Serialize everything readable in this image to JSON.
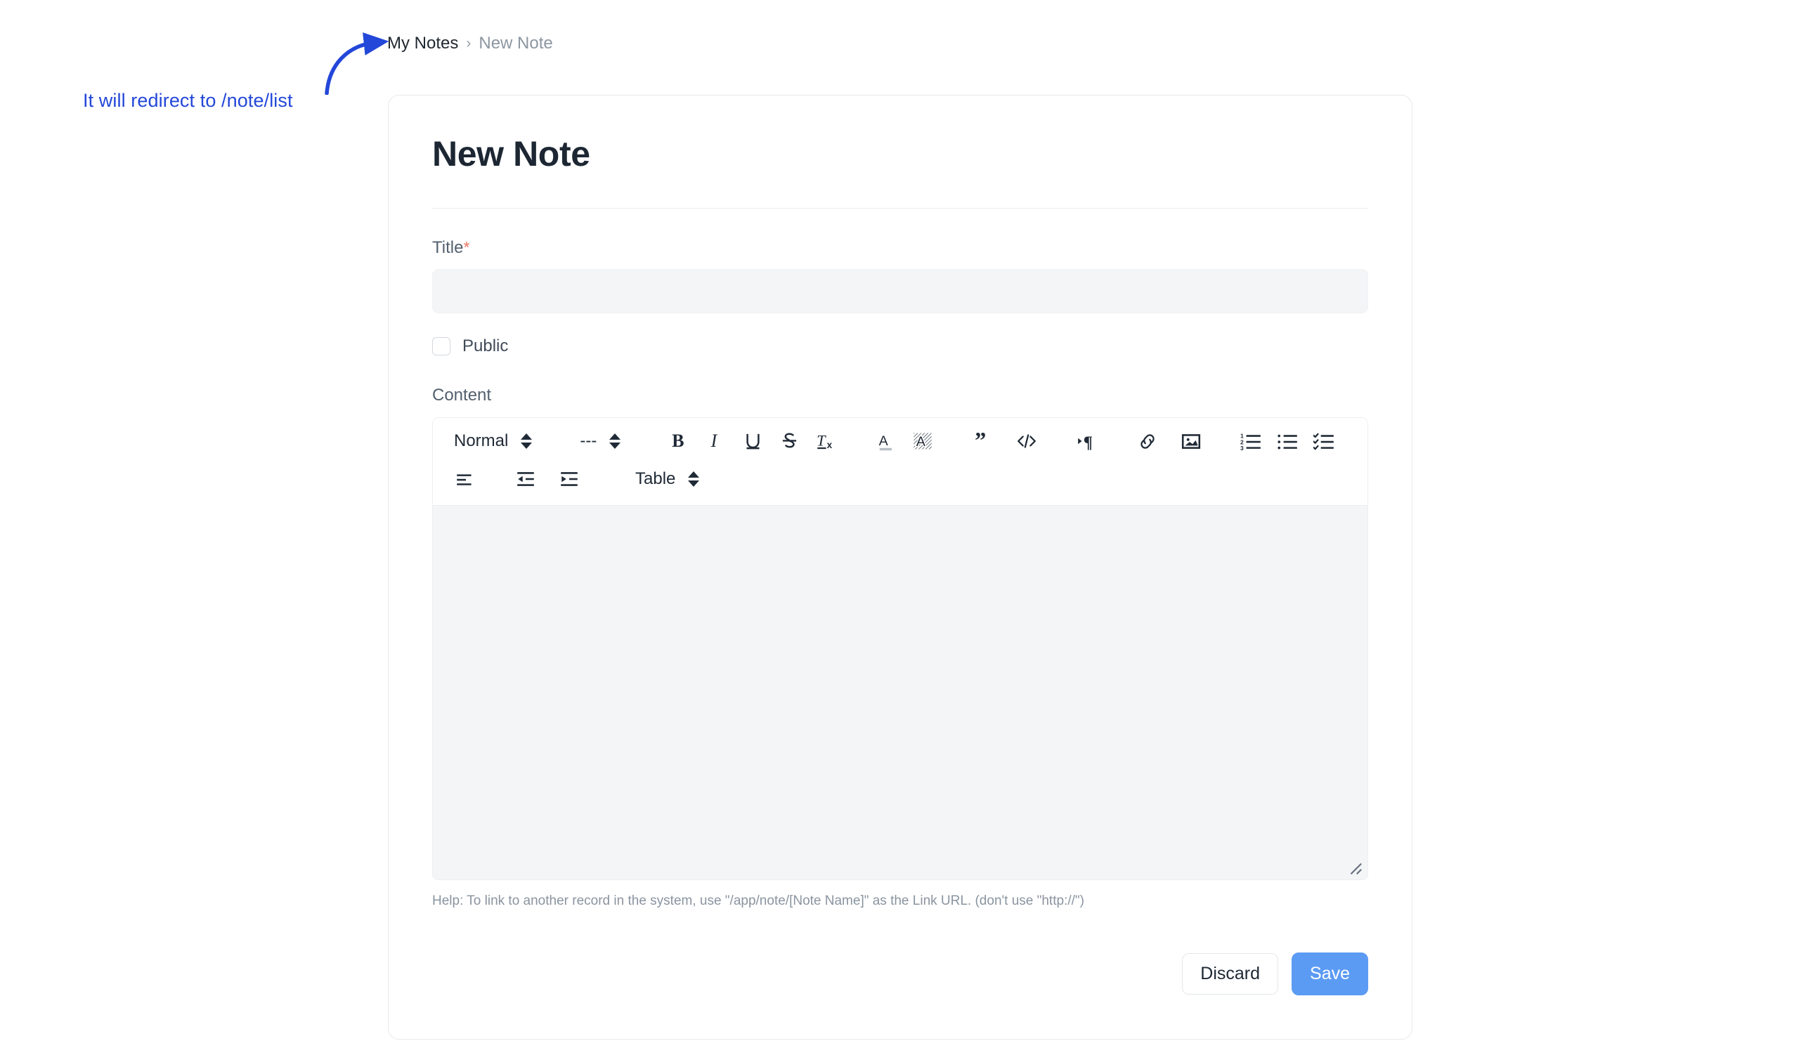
{
  "annotation": {
    "text": "It will redirect to /note/list",
    "color": "#2347d9",
    "arrow_name": "curved-arrow"
  },
  "breadcrumb": {
    "parent": "My Notes",
    "separator": "›",
    "current": "New Note"
  },
  "page": {
    "title": "New Note"
  },
  "form": {
    "title_field": {
      "label": "Title",
      "required_marker": "*",
      "value": "",
      "placeholder": ""
    },
    "public_checkbox": {
      "label": "Public",
      "checked": false
    },
    "content_field": {
      "label": "Content",
      "value": "",
      "help": "Help: To link to another record in the system, use \"/app/note/[Note Name]\" as the Link URL. (don't use \"http://\")"
    }
  },
  "toolbar": {
    "row1": {
      "heading_select": {
        "value": "Normal",
        "icon": "chevron-updown-icon"
      },
      "font_select": {
        "value": "---",
        "icon": "chevron-updown-icon"
      },
      "bold": "B",
      "italic": "I",
      "underline": "U",
      "strikethrough": "S",
      "clear_format": "clear-format-icon",
      "font_color": "font-color-icon",
      "highlight": "highlight-icon",
      "blockquote": "blockquote-icon",
      "code": "code-icon",
      "direction": "text-direction-icon",
      "link": "link-icon",
      "image": "image-icon",
      "ordered_list": "ordered-list-icon",
      "bullet_list": "bullet-list-icon",
      "check_list": "check-list-icon"
    },
    "row2": {
      "align": "align-left-icon",
      "outdent": "outdent-icon",
      "indent": "indent-icon",
      "table_select": {
        "value": "Table",
        "icon": "chevron-updown-icon"
      }
    }
  },
  "actions": {
    "discard_label": "Discard",
    "save_label": "Save",
    "save_color": "#5b9bf3"
  }
}
